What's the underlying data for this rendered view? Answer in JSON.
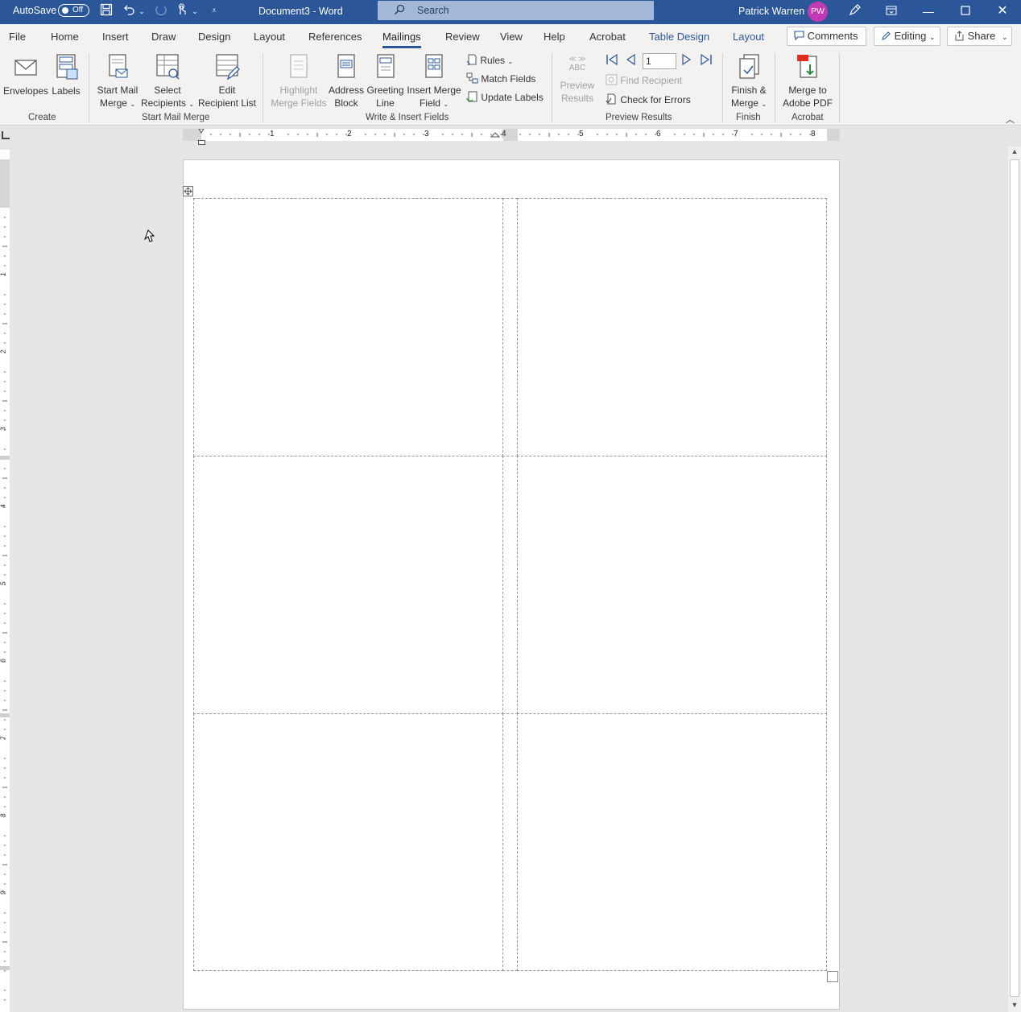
{
  "titlebar": {
    "autosave_label": "AutoSave",
    "autosave_state": "Off",
    "doc_title": "Document3  -  Word",
    "search_placeholder": "Search",
    "user_name": "Patrick Warren",
    "user_initials": "PW"
  },
  "menu": {
    "tabs": [
      "File",
      "Home",
      "Insert",
      "Draw",
      "Design",
      "Layout",
      "References",
      "Mailings",
      "Review",
      "View",
      "Help",
      "Acrobat",
      "Table Design",
      "Layout"
    ],
    "active_tab": "Mailings",
    "comments_label": "Comments",
    "editing_label": "Editing",
    "share_label": "Share"
  },
  "ribbon": {
    "create": {
      "group_label": "Create",
      "envelopes": "Envelopes",
      "labels": "Labels"
    },
    "start": {
      "group_label": "Start Mail Merge",
      "start_line1": "Start Mail",
      "start_line2": "Merge",
      "select_line1": "Select",
      "select_line2": "Recipients",
      "edit_line1": "Edit",
      "edit_line2": "Recipient List"
    },
    "write": {
      "group_label": "Write & Insert Fields",
      "highlight_line1": "Highlight",
      "highlight_line2": "Merge Fields",
      "address_line1": "Address",
      "address_line2": "Block",
      "greeting_line1": "Greeting",
      "greeting_line2": "Line",
      "insert_line1": "Insert Merge",
      "insert_line2": "Field",
      "rules": "Rules",
      "match_fields": "Match Fields",
      "update_labels": "Update Labels"
    },
    "preview": {
      "group_label": "Preview Results",
      "preview_line1": "Preview",
      "preview_line2": "Results",
      "abc_icon_text": "ABC",
      "record_number": "1",
      "find_recipient": "Find Recipient",
      "check_errors": "Check for Errors"
    },
    "finish": {
      "group_label": "Finish",
      "finish_line1": "Finish &",
      "finish_line2": "Merge"
    },
    "acrobat": {
      "group_label": "Acrobat",
      "merge_line1": "Merge to",
      "merge_line2": "Adobe PDF"
    }
  },
  "ruler": {
    "h_numbers": [
      "1",
      "2",
      "3",
      "4",
      "5",
      "6",
      "7",
      "8"
    ],
    "v_numbers": [
      "1",
      "2",
      "3",
      "4",
      "5",
      "6",
      "7",
      "8",
      "9"
    ]
  },
  "colors": {
    "title_bar": "#2b579a",
    "avatar": "#c239b3",
    "accent": "#2b579a"
  }
}
